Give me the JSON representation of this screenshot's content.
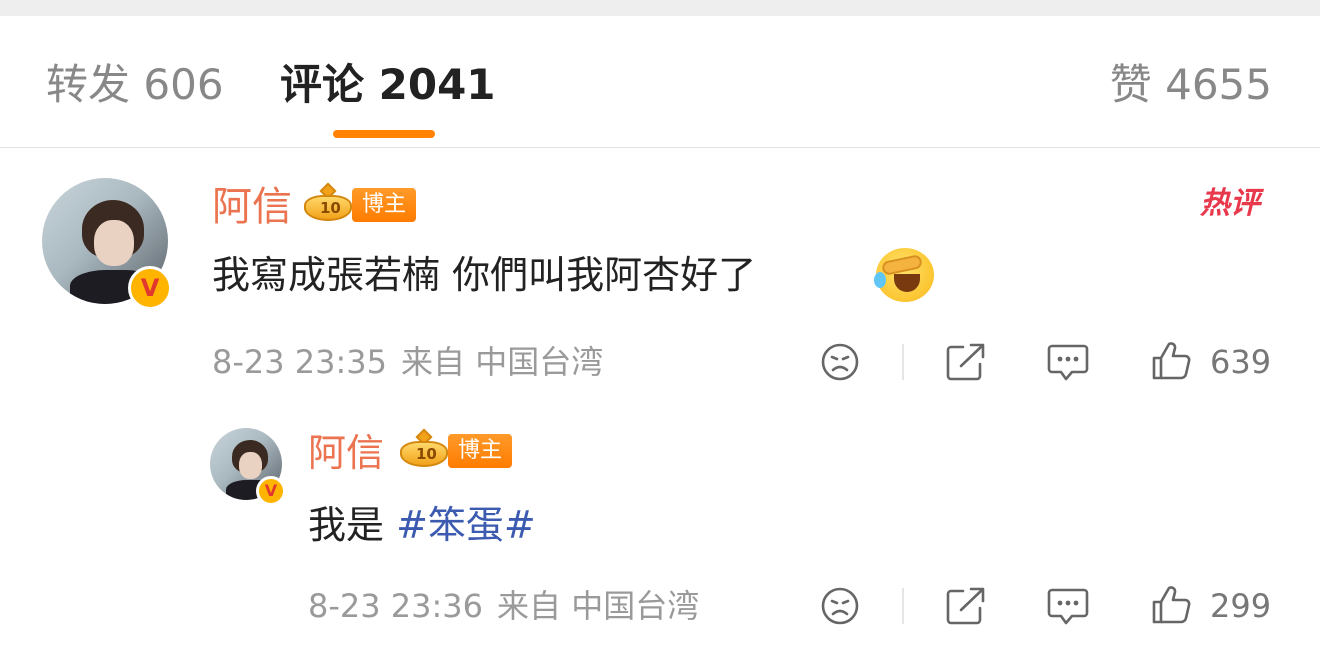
{
  "tabs": {
    "repost": {
      "label": "转发",
      "count": "606"
    },
    "comments": {
      "label": "评论",
      "count": "2041"
    },
    "likes": {
      "label": "赞",
      "count": "4655"
    },
    "active": "comments",
    "accent_color": "#ff8200"
  },
  "comments": [
    {
      "username": "阿信",
      "badge_level": "10",
      "badge_label": "博主",
      "verified_mark": "V",
      "hot_tag": "热评",
      "text": "我寫成張若楠  你們叫我阿杏好了",
      "emoji": "laughing-crying-emoji",
      "date": "8-23",
      "time": "23:35",
      "source": "来自 中国台湾",
      "likes": "639",
      "icons": [
        "dislike-icon",
        "share-icon",
        "comment-icon",
        "like-icon"
      ]
    },
    {
      "username": "阿信",
      "badge_level": "10",
      "badge_label": "博主",
      "verified_mark": "V",
      "text_prefix": "我是 ",
      "hashtag": "#笨蛋#",
      "date": "8-23",
      "time": "23:36",
      "source": "来自 中国台湾",
      "likes": "299",
      "icons": [
        "dislike-icon",
        "share-icon",
        "comment-icon",
        "like-icon"
      ]
    }
  ],
  "colors": {
    "username": "#eb7350",
    "hashtag": "#3c5bb0",
    "hot_tag": "#e8384b",
    "badge": "#ff8200",
    "meta_text": "#9a9a9a"
  }
}
